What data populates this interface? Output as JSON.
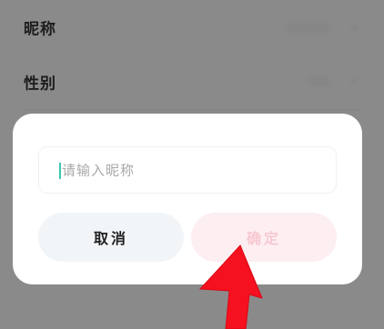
{
  "settings": {
    "rows": [
      {
        "label": "昵称"
      },
      {
        "label": "性别"
      }
    ]
  },
  "dialog": {
    "input": {
      "placeholder": "请输入昵称",
      "value": ""
    },
    "cancel_label": "取消",
    "confirm_label": "确定"
  },
  "colors": {
    "overlay": "#8a8a8a",
    "dialog_bg": "#ffffff",
    "cancel_bg": "#f2f5f8",
    "confirm_bg": "#fdeef1",
    "confirm_text": "#f7c9d2",
    "caret": "#3cc6b0",
    "pointer_arrow": "#f5111f"
  },
  "icons": {
    "row_chevron": "chevron-right-icon",
    "pointer": "red-arrow-pointer-icon"
  }
}
